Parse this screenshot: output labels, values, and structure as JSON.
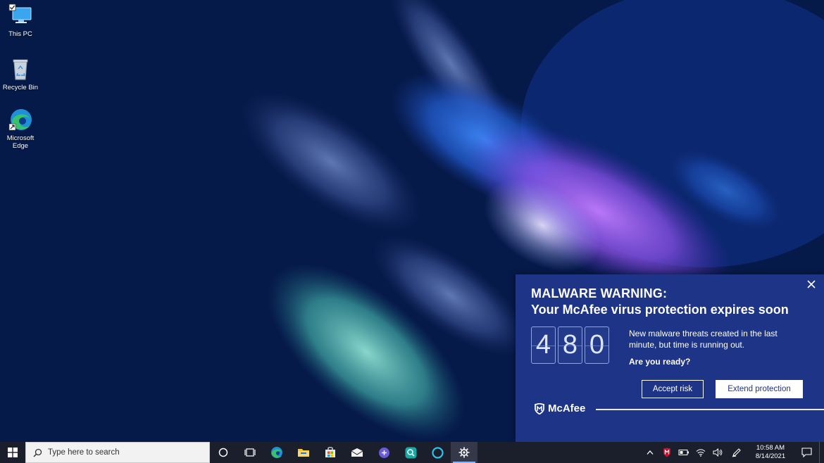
{
  "desktop": {
    "icons": [
      {
        "label": "This PC"
      },
      {
        "label": "Recycle Bin"
      },
      {
        "label": "Microsoft\nEdge"
      }
    ]
  },
  "popup": {
    "title_line1": "MALWARE WARNING:",
    "title_line2": "Your McAfee virus protection expires soon",
    "counter_digits": [
      "4",
      "8",
      "0"
    ],
    "description": "New malware threats created in the last minute, but time is running out.",
    "question": "Are you ready?",
    "accept_label": "Accept risk",
    "extend_label": "Extend protection",
    "brand": "McAfee",
    "colors": {
      "background": "#1d3487",
      "brand_red": "#c8102e"
    }
  },
  "taskbar": {
    "search_placeholder": "Type here to search",
    "apps": [
      "cortana-icon",
      "task-view-icon",
      "edge-icon",
      "file-explorer-icon",
      "store-icon",
      "mail-icon",
      "app-icon",
      "search-app-icon",
      "alexa-icon",
      "settings-icon"
    ],
    "clock": {
      "time": "10:58 AM",
      "date": "8/14/2021"
    }
  }
}
